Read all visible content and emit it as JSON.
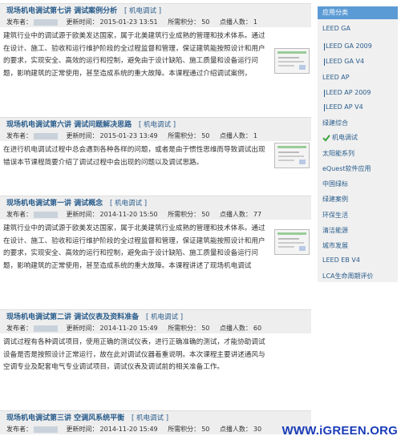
{
  "labels": {
    "author": "发布者：",
    "updated": "更新时间：",
    "credits": "所需积分：",
    "views": "点播人数："
  },
  "articles": [
    {
      "title": "现场机电调试第七讲 调试案例分析",
      "category": "[ 机电调试 ]",
      "updated": "2015-01-23 13:51",
      "credits": "50",
      "views": "1",
      "body": "建筑行业中的调试源于欧美发达国家，属于北美建筑行业成熟的管理和技术体系。通过在设计、施工、验收和运行维护阶段的全过程监督和管理，保证建筑能按照设计和用户的要求，实现安全、高效的运行和控制，避免由于设计缺陷、施工质量和设备运行问题，影响建筑的正常使用，甚至造成系统的重大故障。本课程通过介绍调试案例，"
    },
    {
      "title": "现场机电调试第六讲 调试问题解决思路",
      "category": "[ 机电调试 ]",
      "updated": "2015-01-23 13:49",
      "credits": "50",
      "views": "1",
      "body": "在进行机电调试过程中总会遇到各种各样的问题，或者是由于惯性思维而导致调试出现错误本节课程简要介绍了调试过程中会出现的问题以及调试思路。"
    },
    {
      "title": "现场机电调试第一讲 调试概念",
      "category": "[ 机电调试 ]",
      "updated": "2014-11-20 15:50",
      "credits": "50",
      "views": "77",
      "body": "建筑行业中的调试源于欧美发达国家，属于北美建筑行业成熟的管理和技术体系。通过在设计、施工、验收和运行维护阶段的全过程监督和管理，保证建筑能按照设计和用户的要求，实现安全、高效的运行和控制，避免由于设计缺陷、施工质量和设备运行问题，影响建筑的正常使用，甚至造成系统的重大故障。本课程讲述了现场机电调试"
    },
    {
      "title": "现场机电调试第二讲 调试仪表及资料准备",
      "category": "[ 机电调试 ]",
      "updated": "2014-11-20 15:49",
      "credits": "50",
      "views": "60",
      "body": "调试过程有各种调试项目，使用正确的测试仪表，进行正确准确的测试，才能协助调试设备是否是按照设计正常运行，故在此对调试仪器着重说明。本次课程主要讲述通风与空调专业及配套电气专业调试项目，调试仪表及调试前的相关准备工作。"
    },
    {
      "title": "现场机电调试第三讲 空调风系统平衡",
      "category": "[ 机电调试 ]",
      "updated": "2014-11-20 15:49",
      "credits": "50",
      "views": "30",
      "body": ""
    }
  ],
  "sidebar": {
    "title": "应用分类",
    "items": [
      {
        "label": "LEED GA"
      },
      {
        "label": "LEED GA 2009"
      },
      {
        "label": "LEED GA V4"
      },
      {
        "label": "LEED AP"
      },
      {
        "label": "LEED AP 2009"
      },
      {
        "label": "LEED AP V4"
      },
      {
        "label": "绿建综合"
      },
      {
        "label": "机电调试"
      },
      {
        "label": "太阳能系列"
      },
      {
        "label": "eQuest软件应用"
      },
      {
        "label": "中国绿标"
      },
      {
        "label": "绿建案例"
      },
      {
        "label": "环保生活"
      },
      {
        "label": "清洁能源"
      },
      {
        "label": "城市发展"
      },
      {
        "label": "LEED EB V4"
      },
      {
        "label": "LCA生命周期评价"
      }
    ]
  },
  "watermark": "WWW.iGREEN.ORG",
  "colors": {
    "link": "#2a5d8c",
    "sidebar_header": "#5b9bd5",
    "check": "#3aa33a",
    "watermark": "#1a3cb8"
  }
}
